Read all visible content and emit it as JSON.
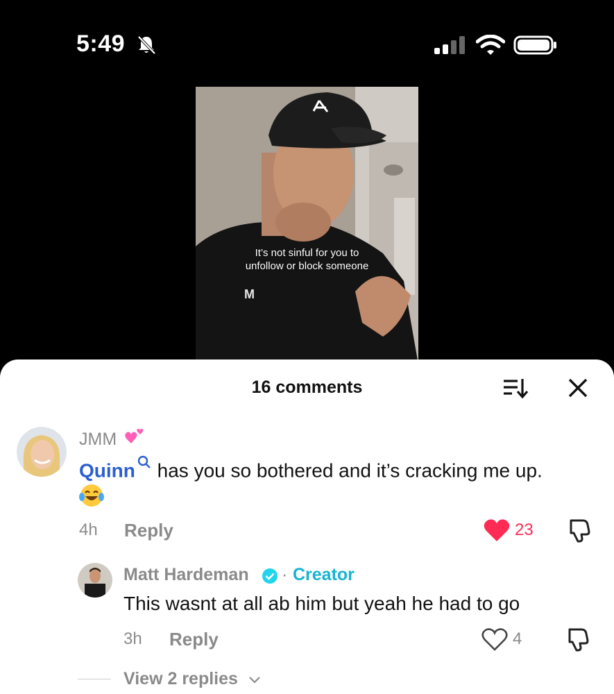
{
  "status_bar": {
    "time": "5:49",
    "icons": [
      "bell-slash-icon",
      "cellular-signal-icon",
      "wifi-icon",
      "battery-icon"
    ]
  },
  "video": {
    "caption_line1": "It’s not sinful for you to",
    "caption_line2": "unfollow or block someone"
  },
  "comments_sheet": {
    "title": "16 comments",
    "comments": [
      {
        "username": "JMM",
        "mention": "Quinn",
        "text": " has you so bothered and it’s cracking me up.",
        "age": "4h",
        "reply_label": "Reply",
        "likes": "23",
        "liked": true
      }
    ],
    "reply": {
      "username": "Matt Hardeman",
      "separator": "·",
      "badge": "Creator",
      "text": "This wasnt at all ab him but yeah he had to go",
      "age": "3h",
      "reply_label": "Reply",
      "likes": "4",
      "liked": false
    },
    "view_replies": "View 2 replies"
  },
  "colors": {
    "like_red": "#fe2c55",
    "mention_blue": "#2b5fcf",
    "creator_cyan": "#17b3d1",
    "muted_gray": "#8a8a8a"
  }
}
